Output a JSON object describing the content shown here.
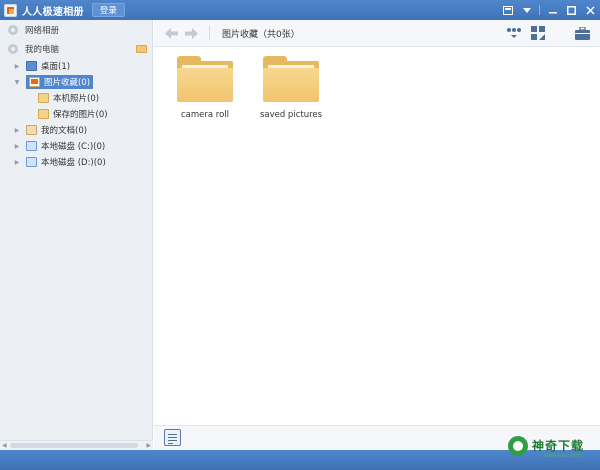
{
  "window": {
    "title": "人人极速相册",
    "login_label": "登录"
  },
  "sidebar": {
    "sections": [
      {
        "label": "网络相册"
      },
      {
        "label": "我的电脑"
      }
    ],
    "tree": [
      {
        "label": "桌面(1)"
      },
      {
        "label": "图片收藏(0)",
        "selected": true
      },
      {
        "label": "本机照片(0)"
      },
      {
        "label": "保存的图片(0)"
      },
      {
        "label": "我的文档(0)"
      },
      {
        "label": "本地磁盘 (C:)(0)"
      },
      {
        "label": "本地磁盘 (D:)(0)"
      }
    ]
  },
  "toolbar": {
    "breadcrumb": "图片收藏（共0张）"
  },
  "content": {
    "folders": [
      {
        "label": "camera roll"
      },
      {
        "label": "saved pictures"
      }
    ]
  },
  "watermark": {
    "brand": "神奇下载",
    "url": "www.sqxz.com"
  },
  "colors": {
    "titlebar": "#4f86cc",
    "selection": "#4f86cc",
    "folder": "#f1c46f",
    "sidebar_bg": "#ecf0f5"
  },
  "icons": {
    "back": "arrow-left-icon",
    "forward": "arrow-right-icon",
    "menu": "chevron-down-icon",
    "minimize": "minimize-icon",
    "maximize": "maximize-icon",
    "close": "close-icon"
  }
}
